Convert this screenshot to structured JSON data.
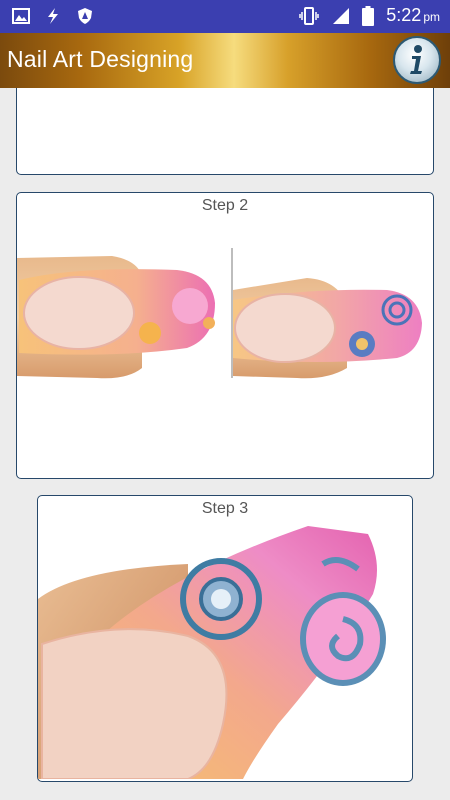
{
  "statusbar": {
    "icons": [
      "image-icon",
      "bolt-icon",
      "shield-icon",
      "vibrate-icon",
      "signal-icon",
      "battery-icon"
    ],
    "time": "5:22",
    "ampm": "pm"
  },
  "appbar": {
    "title": "Nail Art Designing",
    "info_icon": "info-icon"
  },
  "steps": [
    {
      "label": ""
    },
    {
      "label": "Step 2"
    },
    {
      "label": "Step 3"
    }
  ],
  "colors": {
    "statusbar": "#3b3fb0",
    "card_border": "#27486a",
    "background": "#ececec"
  }
}
